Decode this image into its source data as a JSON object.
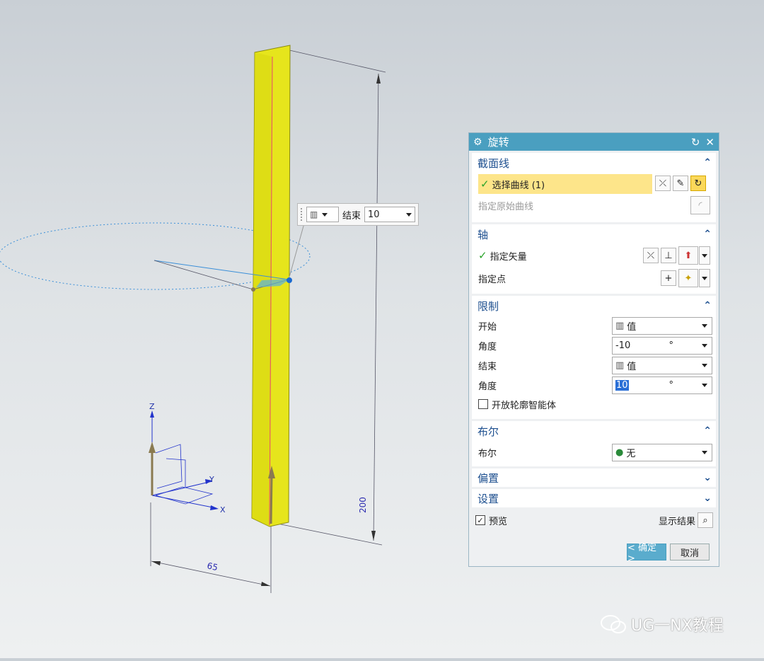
{
  "float_input": {
    "type_icon": "value-icon",
    "label": "结束",
    "value": "10"
  },
  "dimensions": {
    "height": "200",
    "width": "65"
  },
  "triad": {
    "x": "X",
    "y": "Y",
    "z": "Z"
  },
  "dialog": {
    "title": "旋转",
    "sections": {
      "section_curve": {
        "title": "截面线",
        "select_curve": "选择曲线 (1)",
        "specify_original": "指定原始曲线"
      },
      "axis": {
        "title": "轴",
        "specify_vector": "指定矢量",
        "specify_point": "指定点"
      },
      "limits": {
        "title": "限制",
        "start_label": "开始",
        "start_value": "值",
        "start_angle_label": "角度",
        "start_angle": "-10",
        "end_label": "结束",
        "end_value": "值",
        "end_angle_label": "角度",
        "end_angle": "10",
        "unit": "°",
        "open_profile": "开放轮廓智能体"
      },
      "boolean": {
        "title": "布尔",
        "label": "布尔",
        "value": "无"
      },
      "offset": {
        "title": "偏置"
      },
      "settings": {
        "title": "设置"
      }
    },
    "preview_label": "预览",
    "show_result": "显示结果",
    "ok": "< 确定 >",
    "cancel": "取消"
  },
  "watermark": "UG一NX教程",
  "colors": {
    "title_bar": "#4a9fc0",
    "body": "#e6e51c",
    "selection": "#fde58a"
  }
}
